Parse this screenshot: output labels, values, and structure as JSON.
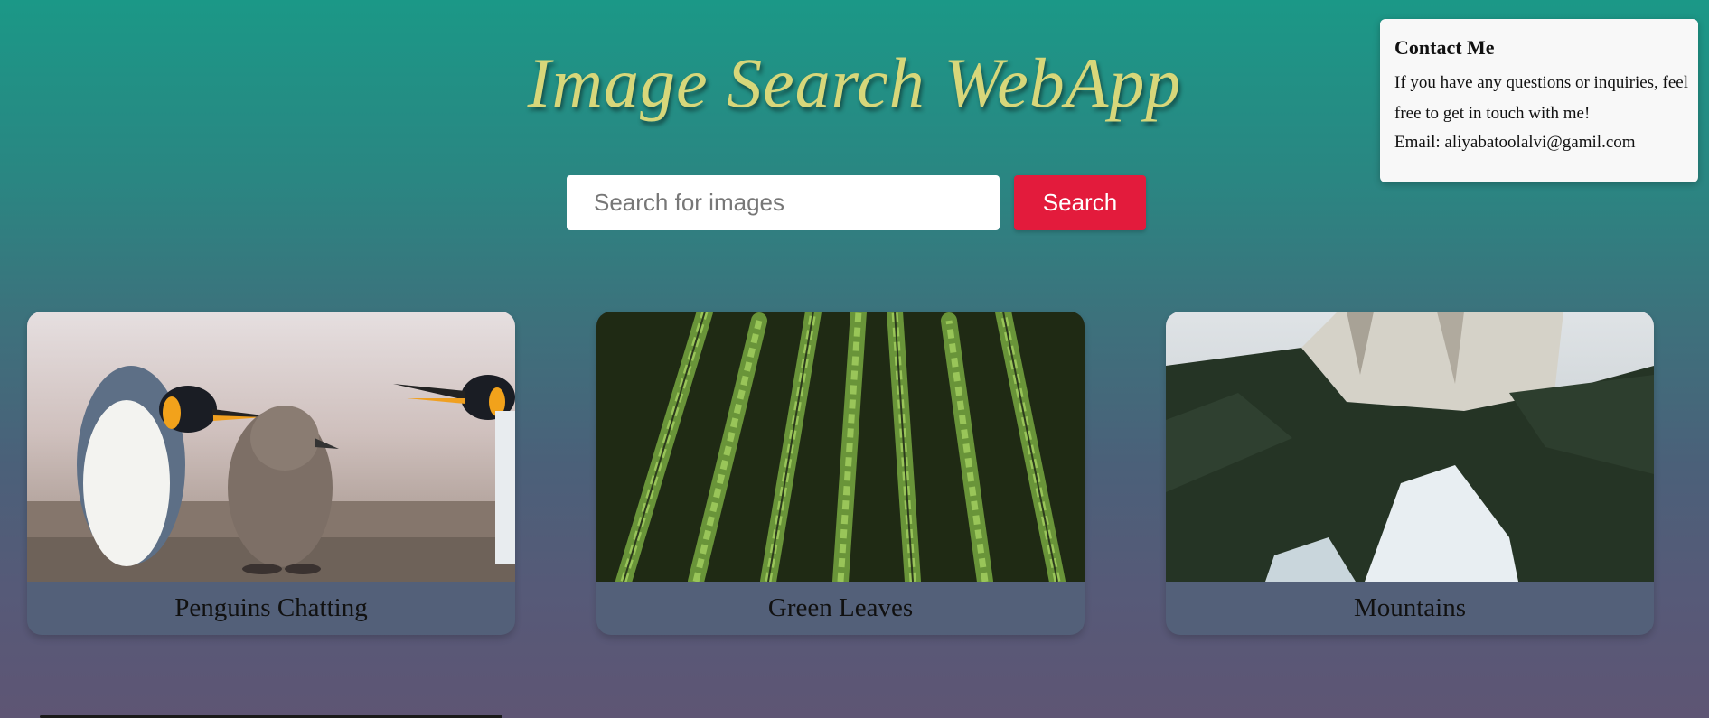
{
  "header": {
    "title": "Image Search WebApp"
  },
  "search": {
    "placeholder": "Search for images",
    "value": "",
    "button_label": "Search"
  },
  "contact": {
    "title": "Contact Me",
    "message": "If you have any questions or inquiries, feel free to get in touch with me!",
    "email": "Email: aliyabatoolalvi@gamil.com"
  },
  "cards": [
    {
      "caption": "Penguins Chatting",
      "image": "penguins-image"
    },
    {
      "caption": "Green Leaves",
      "image": "fern-leaves-image"
    },
    {
      "caption": "Mountains",
      "image": "mountain-forest-image"
    }
  ],
  "colors": {
    "accent": "#e31b3c",
    "title": "#d7d77a",
    "background_top": "#1b9887",
    "background_bottom": "#5e5574"
  }
}
